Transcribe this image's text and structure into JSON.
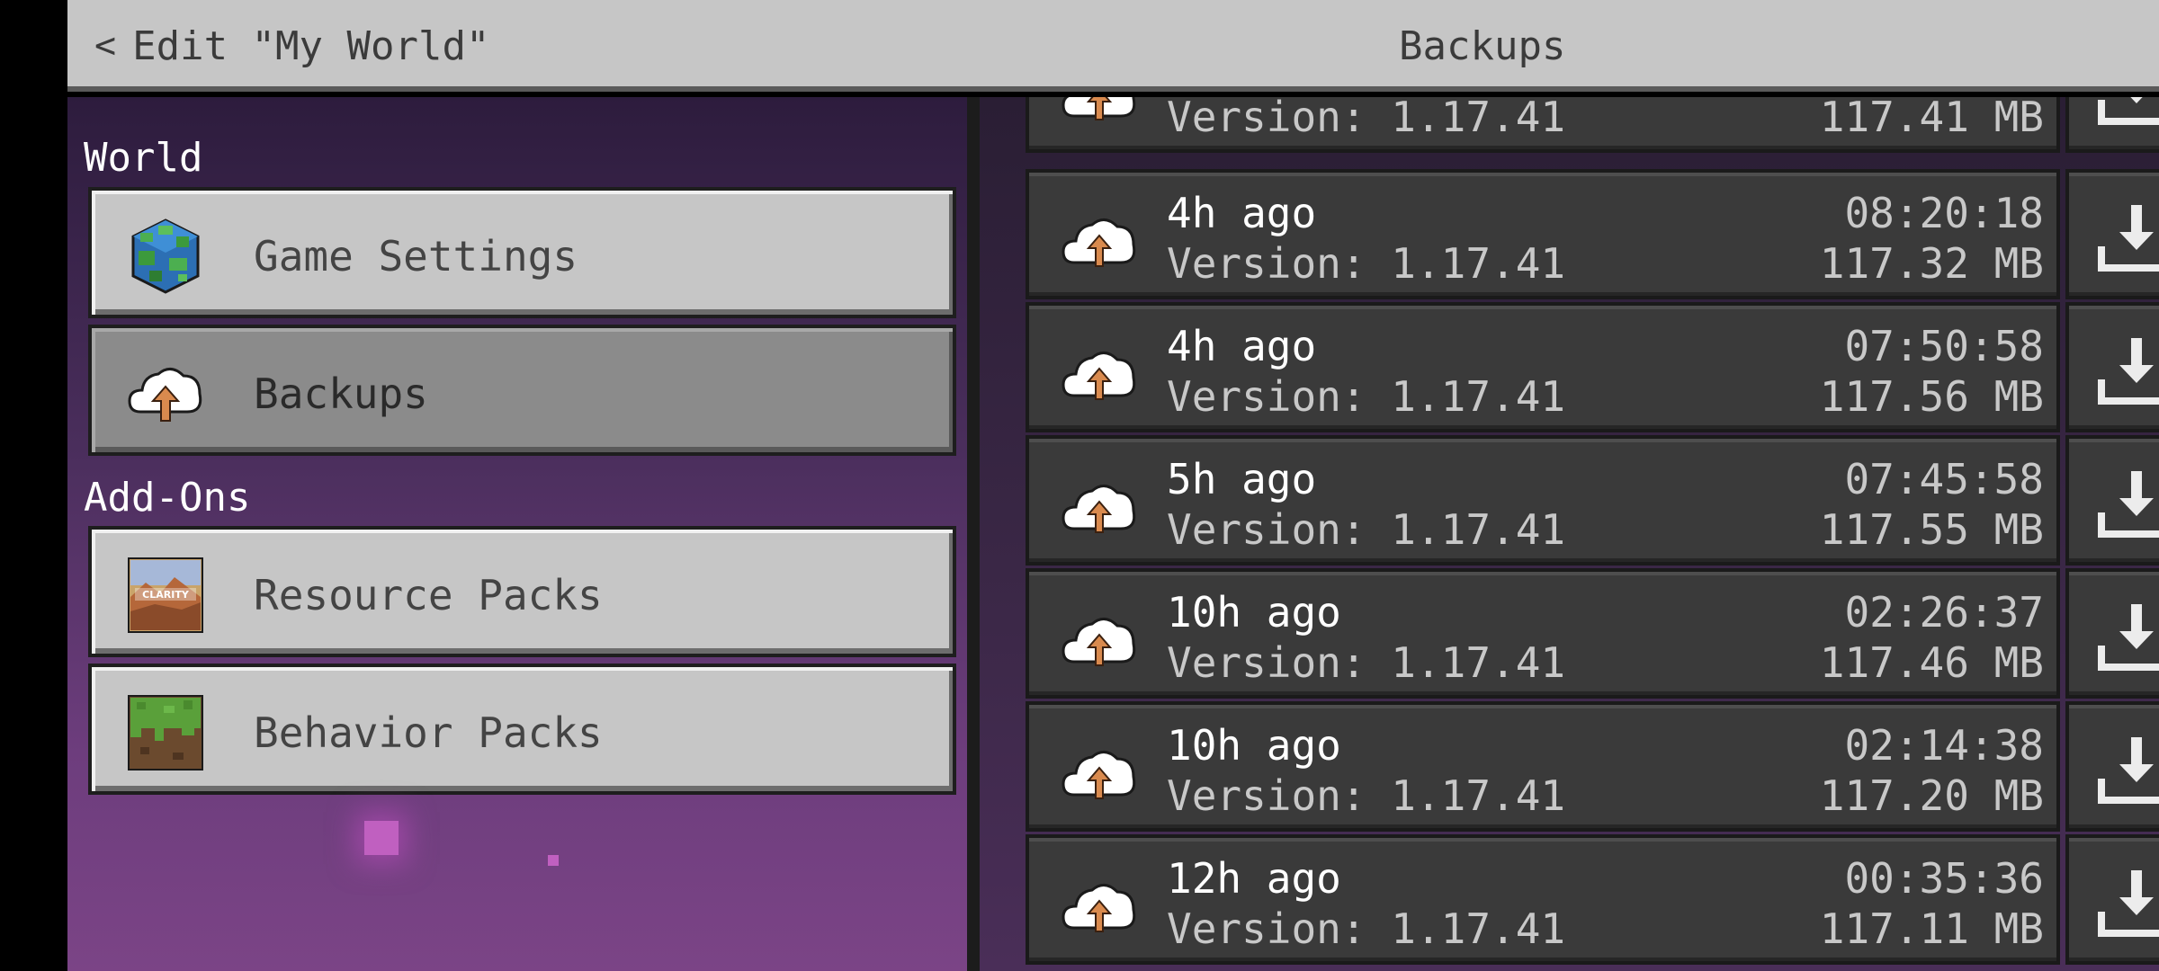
{
  "header": {
    "back_label": "Edit \"My World\"",
    "title": "Backups"
  },
  "sidebar": {
    "world_label": "World",
    "addons_label": "Add-Ons",
    "items": [
      {
        "label": "Game Settings",
        "icon": "globe-icon"
      },
      {
        "label": "Backups",
        "icon": "cloud-upload-icon",
        "selected": true
      },
      {
        "label": "Resource Packs",
        "icon": "resource-pack-icon",
        "pack_name": "CLARITY"
      },
      {
        "label": "Behavior Packs",
        "icon": "grass-block-icon"
      }
    ]
  },
  "backups": [
    {
      "time": "",
      "clock": "",
      "version": "Version: 1.17.41",
      "size": "117.41 MB"
    },
    {
      "time": "4h ago",
      "clock": "08:20:18",
      "version": "Version: 1.17.41",
      "size": "117.32 MB"
    },
    {
      "time": "4h ago",
      "clock": "07:50:58",
      "version": "Version: 1.17.41",
      "size": "117.56 MB"
    },
    {
      "time": "5h ago",
      "clock": "07:45:58",
      "version": "Version: 1.17.41",
      "size": "117.55 MB"
    },
    {
      "time": "10h ago",
      "clock": "02:26:37",
      "version": "Version: 1.17.41",
      "size": "117.46 MB"
    },
    {
      "time": "10h ago",
      "clock": "02:14:38",
      "version": "Version: 1.17.41",
      "size": "117.20 MB"
    },
    {
      "time": "12h ago",
      "clock": "00:35:36",
      "version": "Version: 1.17.41",
      "size": "117.11 MB"
    }
  ],
  "colors": {
    "header_bg": "#c6c6c6",
    "row_bg": "#3a3a3a",
    "accent_arrow": "#d98a4e"
  }
}
